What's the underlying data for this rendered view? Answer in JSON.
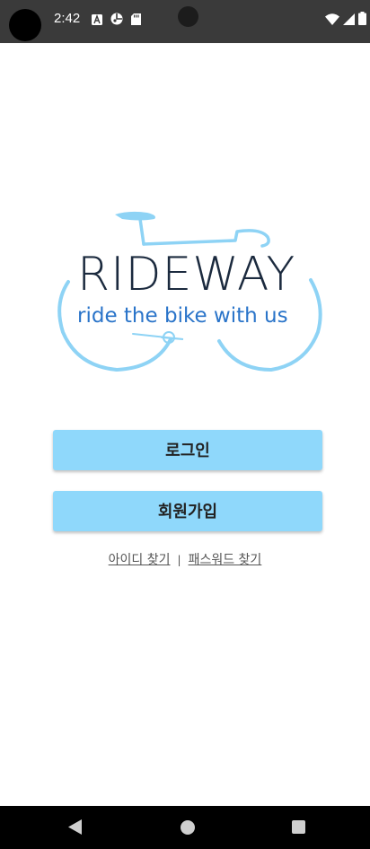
{
  "status_bar": {
    "time": "2:42",
    "icons_left": [
      "a-notification-icon",
      "data-saver-icon",
      "sd-card-icon"
    ],
    "icons_right": [
      "wifi-icon",
      "cell-signal-icon",
      "battery-icon"
    ]
  },
  "logo": {
    "title": "RIDEWAY",
    "tagline": "ride the bike with us",
    "colors": {
      "title": "#1b2a3e",
      "tagline": "#2a74c9",
      "bike": "#8ed3f5"
    }
  },
  "buttons": {
    "login_label": "로그인",
    "signup_label": "회원가입",
    "color": "#8fd8fb"
  },
  "links": {
    "find_id": "아이디 찾기",
    "separator": "|",
    "find_password": "패스워드 찾기"
  },
  "nav_bar": {
    "icons": [
      "back-icon",
      "home-icon",
      "recents-icon"
    ]
  }
}
